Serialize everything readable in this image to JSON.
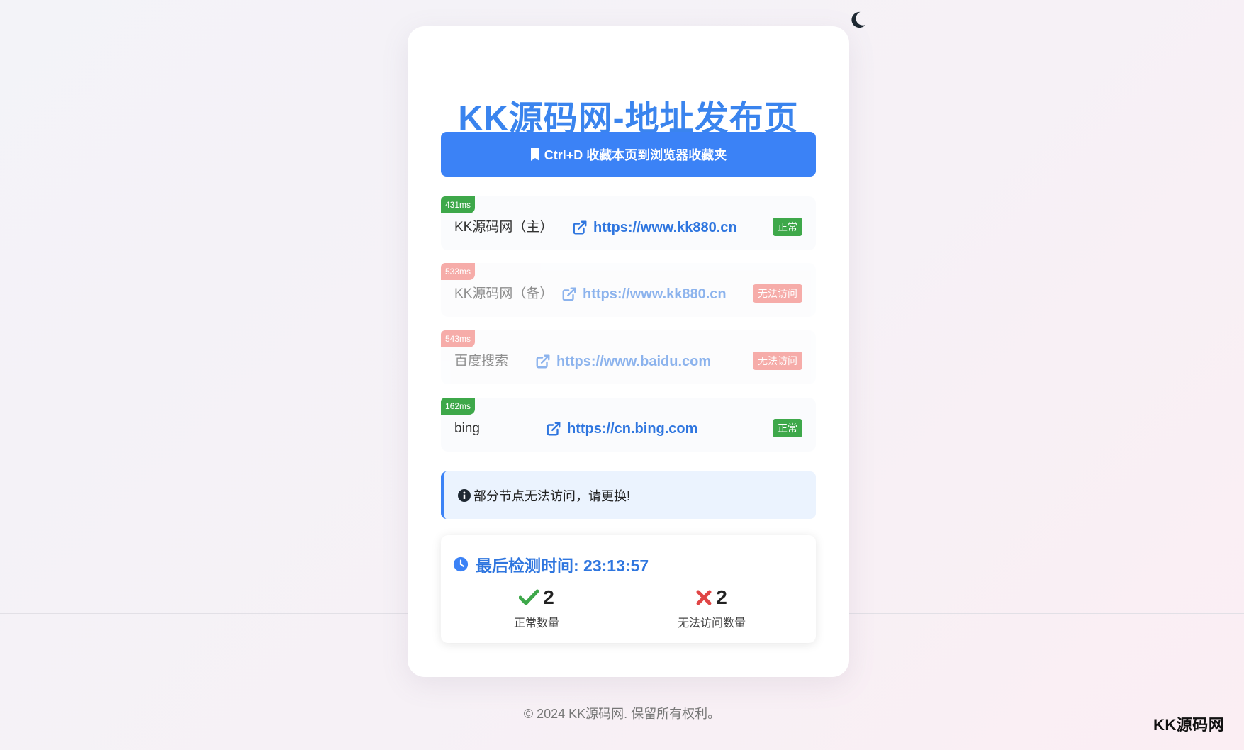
{
  "page": {
    "title": "KK源码网-地址发布页",
    "bookmark_label": "Ctrl+D 收藏本页到浏览器收藏夹",
    "footer": "© 2024 KK源码网. 保留所有权利。",
    "watermark": "KK源码网"
  },
  "links": [
    {
      "ms": "431ms",
      "name": "KK源码网（主）",
      "url": "https://www.kk880.cn",
      "status": "正常",
      "ok": true
    },
    {
      "ms": "533ms",
      "name": "KK源码网（备）",
      "url": "https://www.kk880.cn",
      "status": "无法访问",
      "ok": false
    },
    {
      "ms": "543ms",
      "name": "百度搜索",
      "url": "https://www.baidu.com",
      "status": "无法访问",
      "ok": false
    },
    {
      "ms": "162ms",
      "name": "bing",
      "url": "https://cn.bing.com",
      "status": "正常",
      "ok": true
    }
  ],
  "notice": {
    "text": "部分节点无法访问，请更换!"
  },
  "stats": {
    "last_check": "最后检测时间: 23:13:57",
    "ok_count": "2",
    "ok_label": "正常数量",
    "fail_count": "2",
    "fail_label": "无法访问数量"
  },
  "colors": {
    "accent": "#3b82f6",
    "ok": "#3ea84a",
    "bad": "#ef6a64"
  },
  "icons": [
    "moon-icon",
    "bookmark-icon",
    "external-link-icon",
    "info-icon",
    "clock-icon",
    "check-icon",
    "cross-icon"
  ]
}
